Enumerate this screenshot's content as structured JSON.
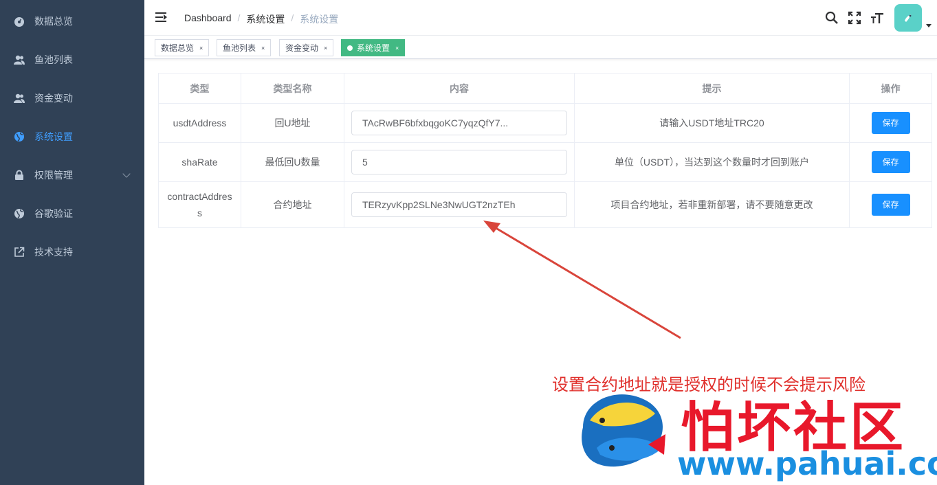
{
  "sidebar": {
    "items": [
      {
        "label": "数据总览",
        "icon": "dashboard-icon"
      },
      {
        "label": "鱼池列表",
        "icon": "user-icon"
      },
      {
        "label": "资金变动",
        "icon": "user-icon"
      },
      {
        "label": "系统设置",
        "icon": "globe-icon",
        "active": true
      },
      {
        "label": "权限管理",
        "icon": "lock-icon"
      },
      {
        "label": "谷歌验证",
        "icon": "globe-icon"
      },
      {
        "label": "技术支持",
        "icon": "external-link-icon"
      }
    ]
  },
  "breadcrumb": [
    "Dashboard",
    "系统设置",
    "系统设置"
  ],
  "tags": [
    {
      "label": "数据总览"
    },
    {
      "label": "鱼池列表"
    },
    {
      "label": "资金变动"
    },
    {
      "label": "系统设置",
      "active": true
    }
  ],
  "table": {
    "headers": [
      "类型",
      "类型名称",
      "内容",
      "提示",
      "操作"
    ],
    "rows": [
      {
        "type": "usdtAddress",
        "name": "回U地址",
        "value": "TAcRwBF6bfxbqgoKC7yqzQfY7...",
        "hint": "请输入USDT地址TRC20",
        "action": "保存"
      },
      {
        "type": "shaRate",
        "name": "最低回U数量",
        "value": "5",
        "hint": "单位（USDT），当达到这个数量时才回到账户",
        "action": "保存"
      },
      {
        "type": "contractAddress",
        "name": "合约地址",
        "value": "TERzyvKpp2SLNe3NwUGT2nzTEh",
        "hint": "项目合约地址，若非重新部署，请不要随意更改",
        "action": "保存"
      }
    ]
  },
  "annotation": "设置合约地址就是授权的时候不会提示风险",
  "watermark": {
    "name": "怕坏社区",
    "url": "www.pahuai.com"
  },
  "colors": {
    "sidebar": "#304156",
    "accent": "#409eff",
    "tag_active": "#42b983",
    "button": "#1890ff"
  }
}
